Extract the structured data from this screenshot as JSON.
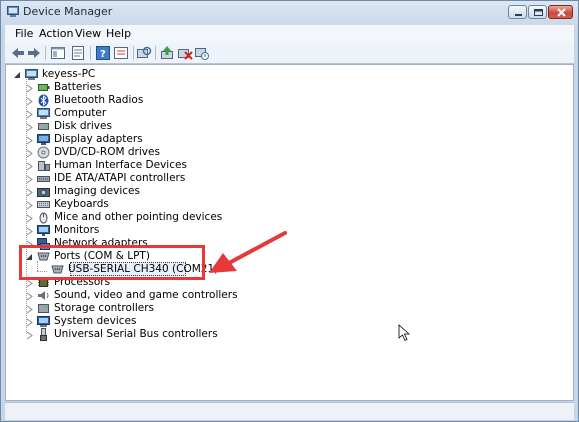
{
  "window": {
    "title": "Device Manager"
  },
  "menu": [
    "File",
    "Action",
    "View",
    "Help"
  ],
  "toolbar_icons": [
    "back-icon",
    "forward-icon",
    "console-tree-icon",
    "properties-icon",
    "help-icon",
    "show-hide-icon",
    "scan-hardware-icon",
    "update-driver-icon",
    "uninstall-icon",
    "disable-icon"
  ],
  "tree": {
    "root": "keyess-PC",
    "categories": [
      {
        "label": "Batteries",
        "icon": "battery-icon"
      },
      {
        "label": "Bluetooth Radios",
        "icon": "bluetooth-icon"
      },
      {
        "label": "Computer",
        "icon": "computer-icon"
      },
      {
        "label": "Disk drives",
        "icon": "disk-drive-icon"
      },
      {
        "label": "Display adapters",
        "icon": "display-adapter-icon"
      },
      {
        "label": "DVD/CD-ROM drives",
        "icon": "dvd-drive-icon"
      },
      {
        "label": "Human Interface Devices",
        "icon": "hid-icon"
      },
      {
        "label": "IDE ATA/ATAPI controllers",
        "icon": "ide-controller-icon"
      },
      {
        "label": "Imaging devices",
        "icon": "camera-icon"
      },
      {
        "label": "Keyboards",
        "icon": "keyboard-icon"
      },
      {
        "label": "Mice and other pointing devices",
        "icon": "mouse-icon"
      },
      {
        "label": "Monitors",
        "icon": "monitor-icon"
      },
      {
        "label": "Network adapters",
        "icon": "network-adapter-icon"
      },
      {
        "label": "Ports (COM & LPT)",
        "icon": "port-icon",
        "expanded": true,
        "children": [
          {
            "label": "USB-SERIAL CH340 (COM21)",
            "icon": "port-icon",
            "selected": true
          }
        ]
      },
      {
        "label": "Processors",
        "icon": "processor-icon"
      },
      {
        "label": "Sound, video and game controllers",
        "icon": "sound-icon"
      },
      {
        "label": "Storage controllers",
        "icon": "storage-controller-icon"
      },
      {
        "label": "System devices",
        "icon": "system-device-icon"
      },
      {
        "label": "Universal Serial Bus controllers",
        "icon": "usb-icon"
      }
    ]
  },
  "colors": {
    "annotation": "#e8393a",
    "selection_bg": "#e9f0fb"
  }
}
